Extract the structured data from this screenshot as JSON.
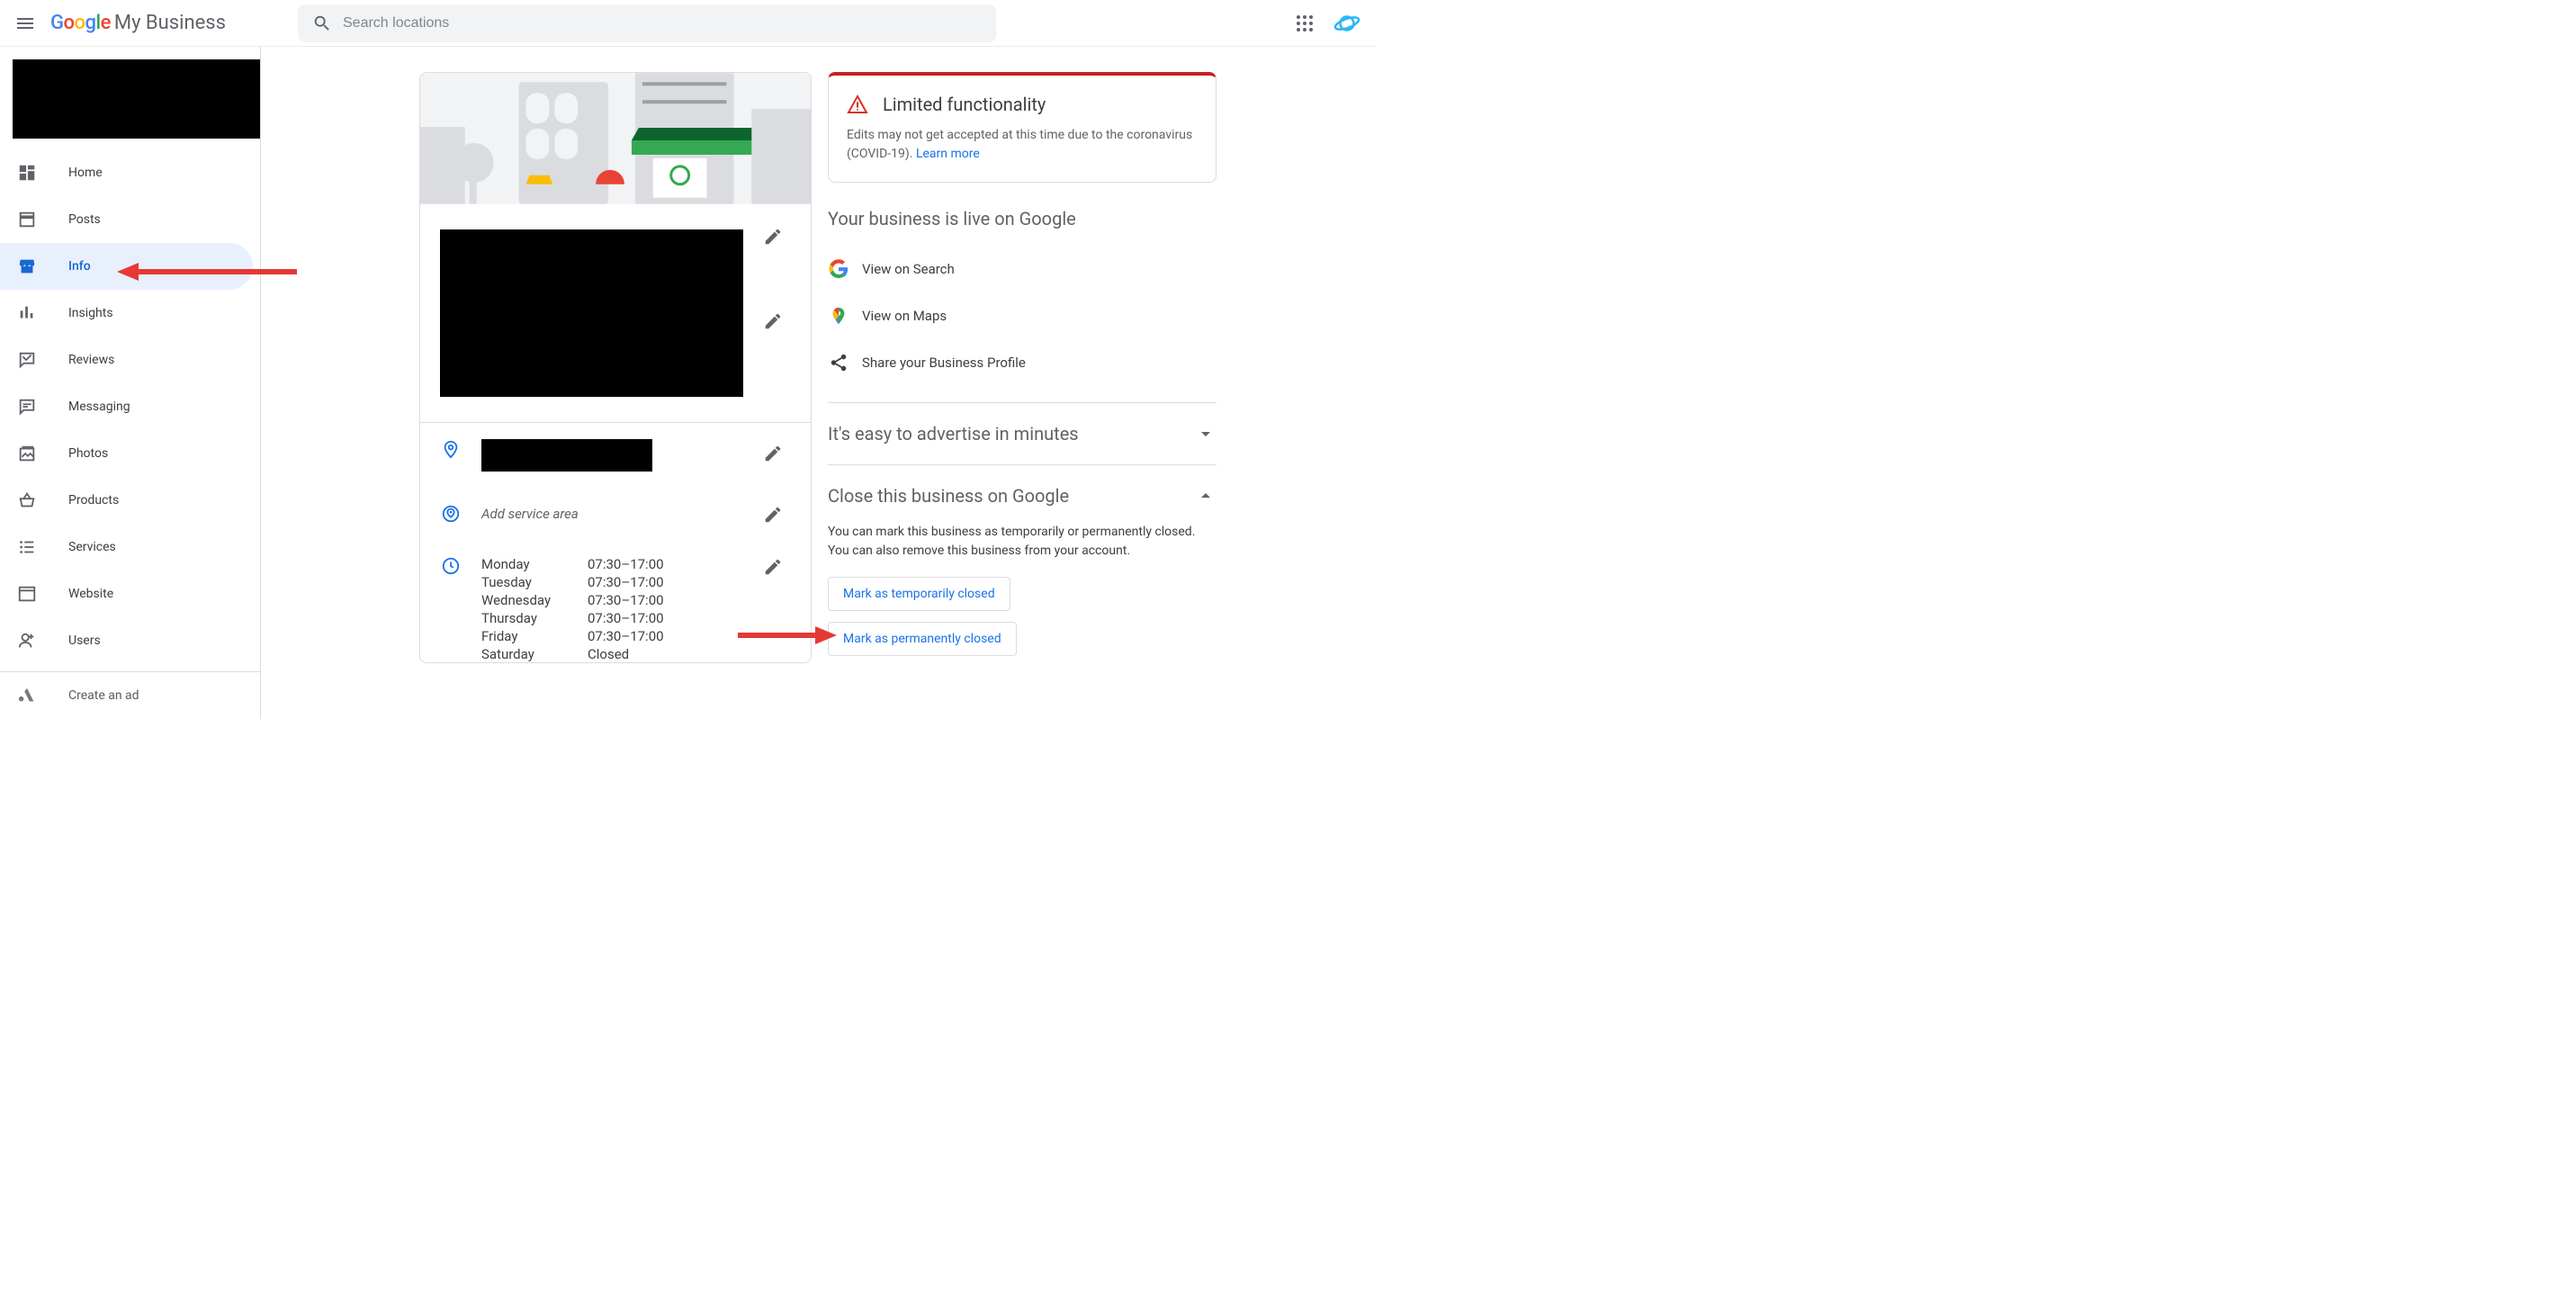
{
  "header": {
    "brand_google": "Google",
    "brand_mb": "My Business",
    "search_placeholder": "Search locations"
  },
  "sidebar": {
    "items": [
      {
        "label": "Home"
      },
      {
        "label": "Posts"
      },
      {
        "label": "Info"
      },
      {
        "label": "Insights"
      },
      {
        "label": "Reviews"
      },
      {
        "label": "Messaging"
      },
      {
        "label": "Photos"
      },
      {
        "label": "Products"
      },
      {
        "label": "Services"
      },
      {
        "label": "Website"
      },
      {
        "label": "Users"
      }
    ],
    "create_ad": "Create an ad"
  },
  "info": {
    "service_area_placeholder": "Add service area",
    "hours": [
      {
        "day": "Monday",
        "time": "07:30–17:00"
      },
      {
        "day": "Tuesday",
        "time": "07:30–17:00"
      },
      {
        "day": "Wednesday",
        "time": "07:30–17:00"
      },
      {
        "day": "Thursday",
        "time": "07:30–17:00"
      },
      {
        "day": "Friday",
        "time": "07:30–17:00"
      },
      {
        "day": "Saturday",
        "time": "Closed"
      }
    ]
  },
  "alert": {
    "title": "Limited functionality",
    "body": "Edits may not get accepted at this time due to the coronavirus (COVID-19). ",
    "learn_more": "Learn more"
  },
  "live": {
    "title": "Your business is live on Google",
    "view_search": "View on Search",
    "view_maps": "View on Maps",
    "share": "Share your Business Profile"
  },
  "advertise": {
    "title": "It's easy to advertise in minutes"
  },
  "close": {
    "title": "Close this business on Google",
    "desc": "You can mark this business as temporarily or permanently closed. You can also remove this business from your account.",
    "temp": "Mark as temporarily closed",
    "perm": "Mark as permanently closed"
  }
}
